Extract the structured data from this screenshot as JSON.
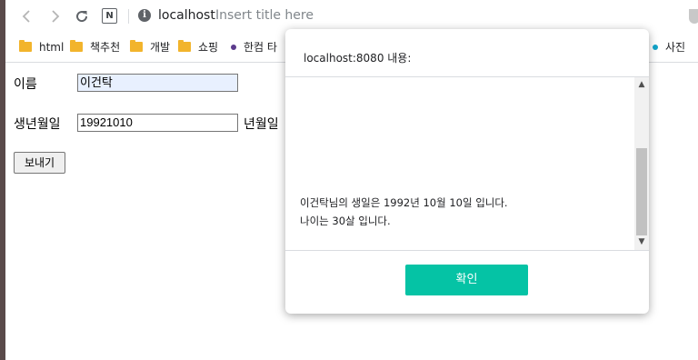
{
  "browser": {
    "url_host": "localhost",
    "title_placeholder": "Insert title here",
    "notion_label": "N",
    "info_glyph": "i"
  },
  "bookmarks": [
    {
      "label": "html",
      "type": "folder"
    },
    {
      "label": "책추천",
      "type": "folder"
    },
    {
      "label": "개발",
      "type": "folder"
    },
    {
      "label": "쇼핑",
      "type": "folder"
    },
    {
      "label": "한컴 타",
      "type": "site",
      "color": "#5b3a8c"
    },
    {
      "label": "사진 ",
      "type": "site",
      "color": "#12a4c9"
    }
  ],
  "form": {
    "name_label": "이름",
    "name_value": "이건탁",
    "birth_label": "생년월일",
    "birth_value": "19921010",
    "birth_hint": "년월일",
    "submit_label": "보내기"
  },
  "dialog": {
    "title": "localhost:8080 내용:",
    "line1": "이건탁님의 생일은 1992년 10월 10일 입니다.",
    "line2": "나이는 30살 입니다.",
    "ok_label": "확인"
  },
  "colors": {
    "accent": "#05c3a5",
    "folder": "#f2b42c"
  }
}
